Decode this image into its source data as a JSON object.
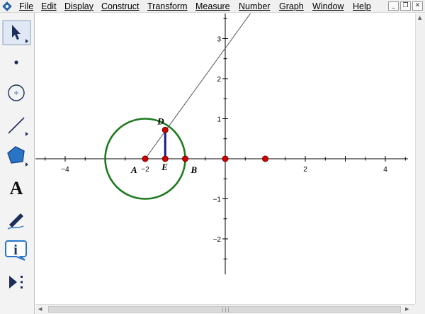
{
  "menubar": {
    "items": [
      "File",
      "Edit",
      "Display",
      "Construct",
      "Transform",
      "Measure",
      "Number",
      "Graph",
      "Window",
      "Help"
    ]
  },
  "window_controls": [
    "minimize-icon",
    "restore-icon",
    "close-icon"
  ],
  "toolbox": {
    "tools": [
      "arrow-select-tool",
      "point-tool",
      "compass-tool",
      "straightedge-tool",
      "polygon-tool",
      "text-tool",
      "marker-tool",
      "information-tool",
      "custom-tool"
    ],
    "text_tool_glyph": "A",
    "info_tool_glyph": "i"
  },
  "graph": {
    "x_ticks": [
      -4,
      -2,
      2,
      4
    ],
    "y_ticks": [
      3,
      2,
      1,
      -1,
      -2
    ],
    "x_tick_labels": [
      "−4",
      "−2",
      "2",
      "4"
    ],
    "y_tick_labels": [
      "3",
      "2",
      "1",
      "−1",
      "−2"
    ],
    "circle": {
      "center": [
        -2,
        0
      ],
      "radius": 1,
      "color": "#1e7a1e"
    },
    "ray": {
      "from": [
        -2,
        0
      ],
      "through": [
        -1.5,
        0.69
      ]
    },
    "segment_DE": {
      "from": [
        -1.5,
        0.72
      ],
      "to": [
        -1.5,
        0
      ],
      "color": "#1a1a8c"
    },
    "points": [
      {
        "name": "A",
        "x": -2,
        "y": 0,
        "label": "A"
      },
      {
        "name": "B",
        "x": -1,
        "y": 0,
        "label": "B"
      },
      {
        "name": "D",
        "x": -1.5,
        "y": 0.72,
        "label": "D"
      },
      {
        "name": "E",
        "x": -1.5,
        "y": 0,
        "label": "E"
      },
      {
        "name": "origin",
        "x": 0,
        "y": 0,
        "label": ""
      },
      {
        "name": "unit",
        "x": 1,
        "y": 0,
        "label": ""
      }
    ],
    "point_color": "#d40000"
  }
}
